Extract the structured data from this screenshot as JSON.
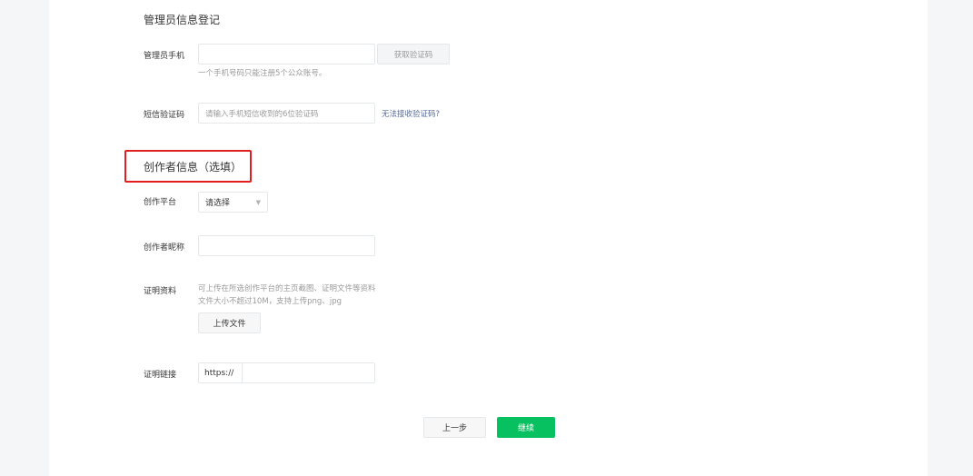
{
  "admin_section": {
    "title": "管理员信息登记",
    "phone_label": "管理员手机",
    "phone_value": "",
    "get_code_button": "获取验证码",
    "phone_hint": "一个手机号码只能注册5个公众账号。",
    "sms_label": "短信验证码",
    "sms_placeholder": "请输入手机短信收到的6位验证码",
    "sms_help_link": "无法接收验证码?"
  },
  "creator_section": {
    "title": "创作者信息（选填）",
    "platform_label": "创作平台",
    "platform_selected": "请选择",
    "nickname_label": "创作者昵称",
    "nickname_value": "",
    "proof_label": "证明资料",
    "proof_hint_1": "可上传在所选创作平台的主页截图、证明文件等资料",
    "proof_hint_2": "文件大小不超过10M，支持上传png、jpg",
    "upload_button": "上传文件",
    "link_label": "证明链接",
    "link_prefix": "https://",
    "link_value": ""
  },
  "footer": {
    "prev_button": "上一步",
    "continue_button": "继续"
  },
  "colors": {
    "primary": "#07c160",
    "link": "#576b95",
    "highlight": "#e02020"
  }
}
